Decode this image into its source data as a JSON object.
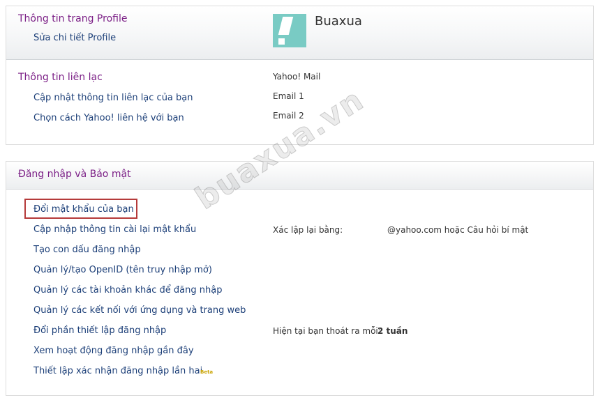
{
  "profile_panel": {
    "section_title": "Thông tin trang Profile",
    "edit_link": "Sửa chi tiết Profile",
    "username": "Buaxua"
  },
  "contact_panel": {
    "section_title": "Thông tin liên lạc",
    "links": [
      "Cập nhật thông tin liên lạc của bạn",
      "Chọn cách Yahoo! liên hệ với bạn"
    ],
    "values": [
      "Yahoo! Mail",
      "Email 1",
      "Email 2"
    ]
  },
  "security_panel": {
    "section_title": "Đăng nhập và Bảo mật",
    "links": [
      "Đổi mật khẩu của bạn",
      "Cập nhập thông tin cài lại mật khẩu",
      "Tạo con dấu đăng nhập",
      "Quản lý/tạo OpenID (tên truy nhập mở)",
      "Quản lý các tài khoản khác để đăng nhập",
      "Quản lý các kết nối với ứng dụng và trang web",
      "Đổi phần thiết lập đăng nhập",
      "Xem hoạt động đăng nhập gần đây",
      "Thiết lập xác nhận đăng nhập lần hai"
    ],
    "beta_label": "Beta",
    "reset_label": "Xác lập lại bằng:",
    "reset_value": "@yahoo.com hoặc Câu hỏi bí mật",
    "signout_label": "Hiện tại bạn thoát ra mỗi:",
    "signout_value": "2 tuần"
  },
  "watermark": "buaxua.vn",
  "colors": {
    "section_title": "#7b1f86",
    "link": "#1c3f78",
    "highlight": "#b53a3a",
    "avatar_bg": "#79cbc4"
  },
  "icons": {
    "avatar": "yahoo-exclamation-avatar-icon"
  }
}
